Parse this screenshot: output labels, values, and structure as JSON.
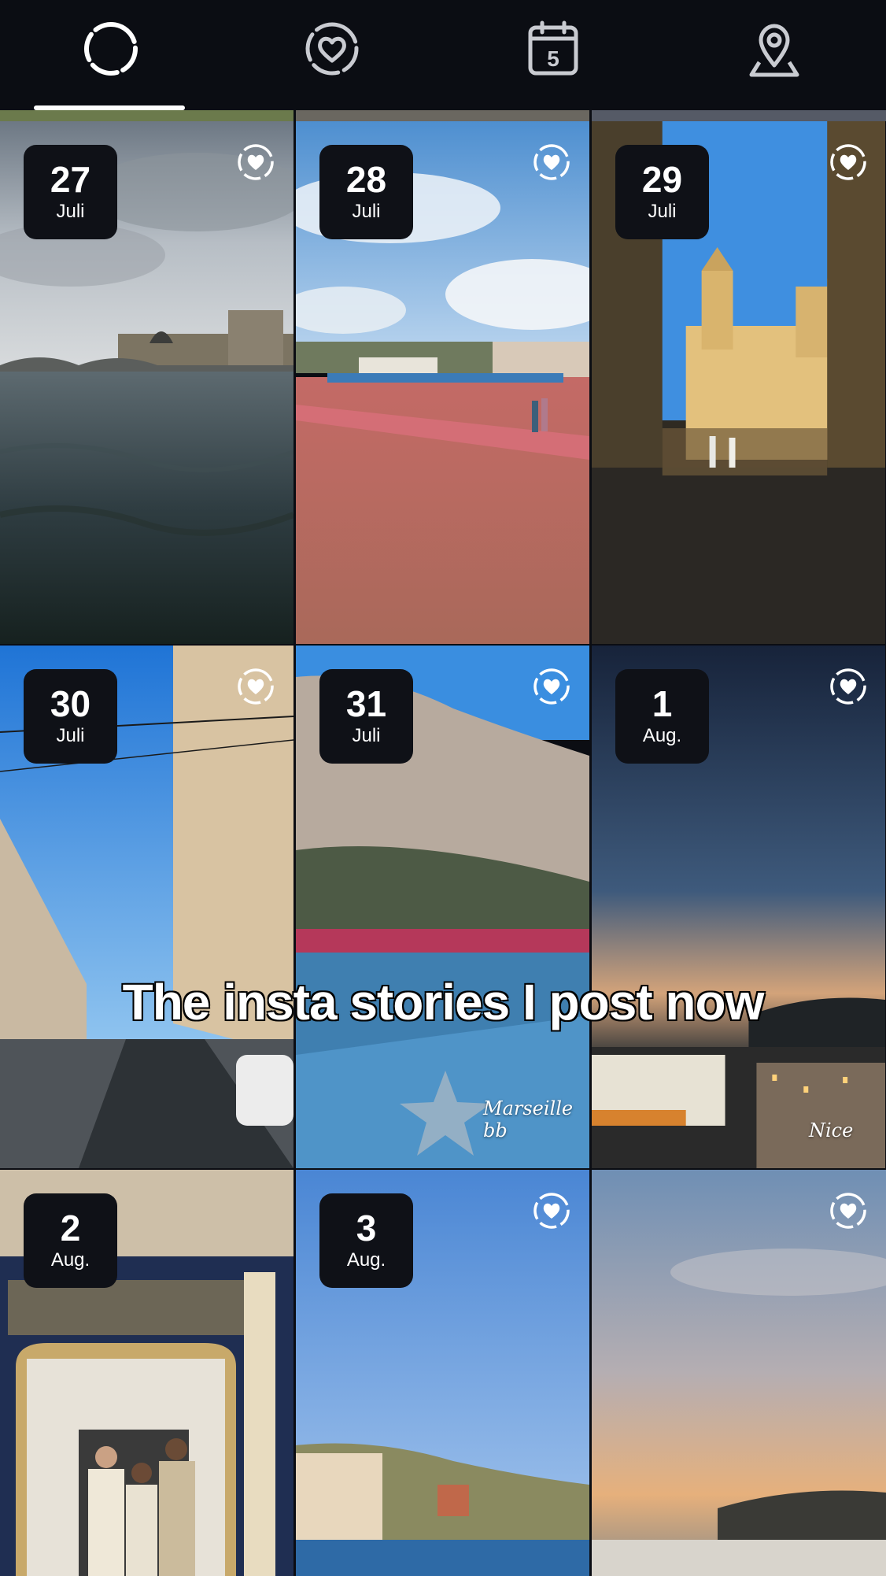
{
  "tabs": [
    {
      "name": "stories",
      "icon": "dashed-circle-icon"
    },
    {
      "name": "highlights",
      "icon": "heart-dashed-circle-icon"
    },
    {
      "name": "calendar",
      "icon": "calendar-icon",
      "label": "5"
    },
    {
      "name": "map",
      "icon": "map-pin-icon"
    }
  ],
  "overlay_text": "The insta stories I post now",
  "stories": [
    {
      "day": "27",
      "month": "Juli"
    },
    {
      "day": "28",
      "month": "Juli"
    },
    {
      "day": "29",
      "month": "Juli"
    },
    {
      "day": "30",
      "month": "Juli"
    },
    {
      "day": "31",
      "month": "Juli",
      "caption": "Marseille bb"
    },
    {
      "day": "1",
      "month": "Aug.",
      "caption": "Nice"
    },
    {
      "day": "2",
      "month": "Aug."
    },
    {
      "day": "3",
      "month": "Aug."
    },
    {}
  ],
  "colors": {
    "background": "#0b0d13",
    "badge": "#0f1117",
    "icon": "#c9cbd1",
    "active_underline": "#ffffff"
  }
}
